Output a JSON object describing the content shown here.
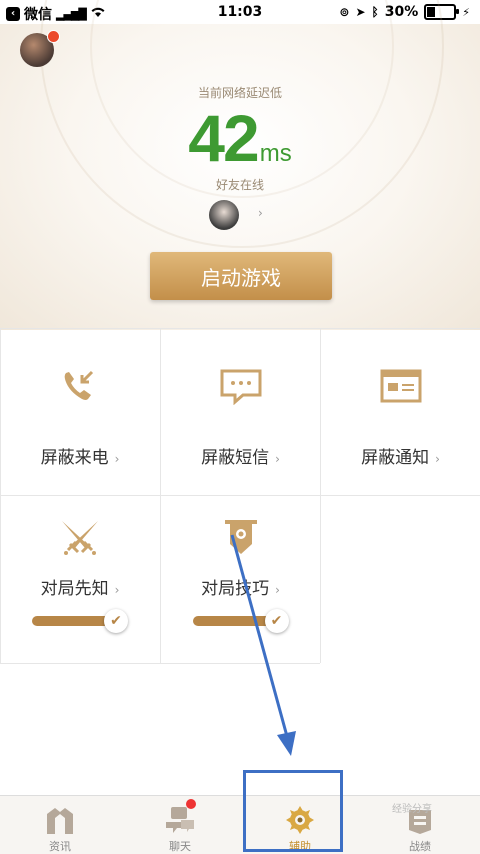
{
  "status_bar": {
    "carrier": "微信",
    "time": "11:03",
    "battery": "30%",
    "battery_level": 0.3
  },
  "hero": {
    "latency_label": "当前网络延迟低",
    "latency_value": "42",
    "latency_unit": "ms",
    "friends_label": "好友在线",
    "start_button": "启动游戏"
  },
  "features": [
    {
      "label": "屏蔽来电",
      "icon": "phone-incoming-icon"
    },
    {
      "label": "屏蔽短信",
      "icon": "message-icon"
    },
    {
      "label": "屏蔽通知",
      "icon": "notification-card-icon"
    },
    {
      "label": "对局先知",
      "icon": "crossed-swords-icon",
      "toggle": true
    },
    {
      "label": "对局技巧",
      "icon": "banner-icon",
      "toggle": true
    }
  ],
  "tabs": [
    {
      "label": "资讯",
      "icon": "news-icon"
    },
    {
      "label": "聊天",
      "icon": "chat-icon",
      "badge": true
    },
    {
      "label": "辅助",
      "icon": "assist-gear-icon",
      "active": true
    },
    {
      "label": "战绩",
      "icon": "stats-icon"
    }
  ],
  "watermark": "经验分享",
  "colors": {
    "accent": "#c4902f",
    "latency_green": "#3e9a32",
    "annotation_blue": "#3d6fc4",
    "badge_red": "#ec4a2c"
  }
}
